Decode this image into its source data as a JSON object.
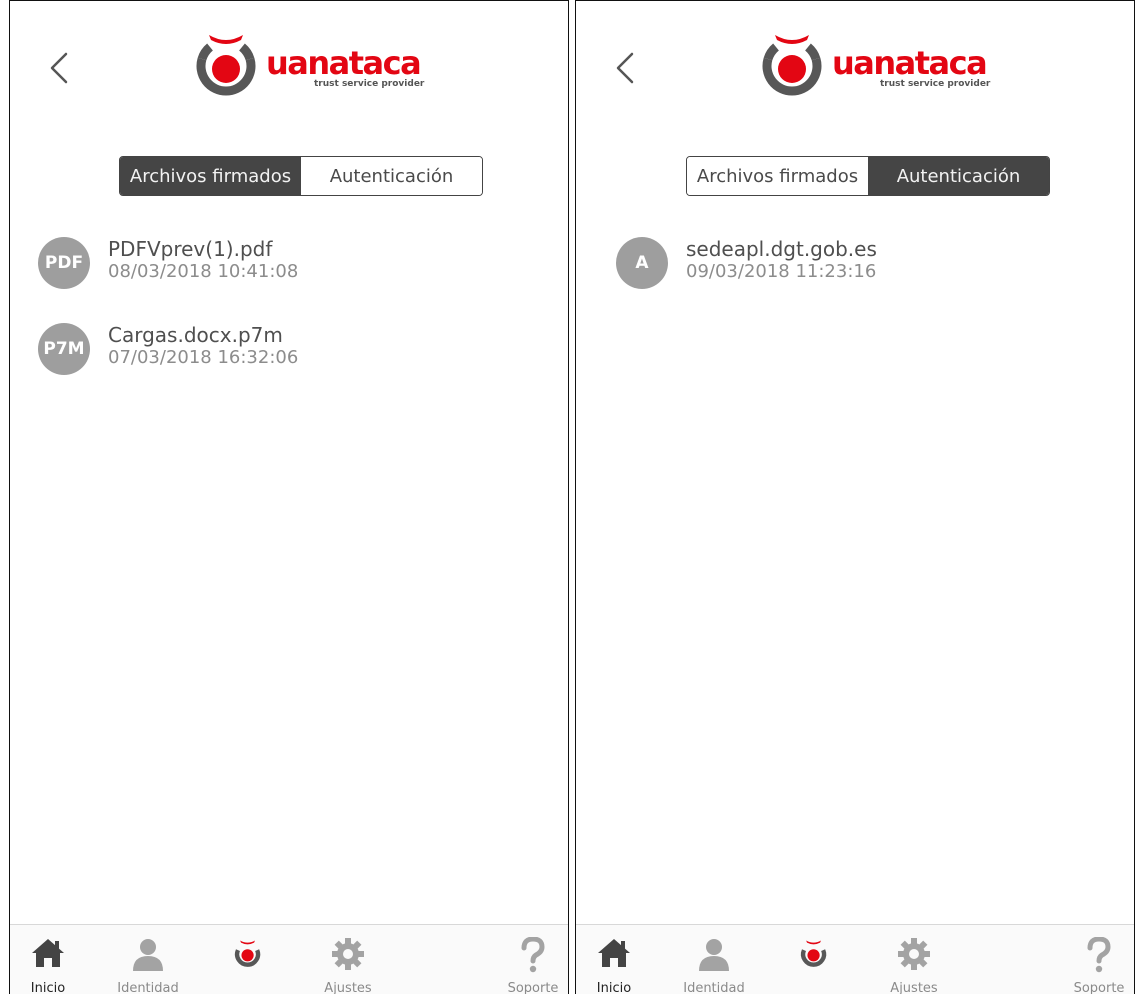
{
  "brand": {
    "wordmark": "uanataca",
    "tagline": "trust service provider",
    "red": "#e30613",
    "gray": "#575757"
  },
  "screens": [
    {
      "segments": [
        {
          "label": "Archivos firmados",
          "active": true
        },
        {
          "label": "Autenticación",
          "active": false
        }
      ],
      "items": [
        {
          "badge": "PDF",
          "title": "PDFVprev(1).pdf",
          "date": "08/03/2018 10:41:08"
        },
        {
          "badge": "P7M",
          "title": "Cargas.docx.p7m",
          "date": "07/03/2018 16:32:06"
        }
      ]
    },
    {
      "segments": [
        {
          "label": "Archivos firmados",
          "active": false
        },
        {
          "label": "Autenticación",
          "active": true
        }
      ],
      "items": [
        {
          "badge": "A",
          "title": "sedeapl.dgt.gob.es",
          "date": "09/03/2018 11:23:16"
        }
      ]
    }
  ],
  "tabbar": {
    "tabs": [
      {
        "label": "Inicio",
        "icon": "home-icon",
        "active": true
      },
      {
        "label": "Identidad",
        "icon": "person-icon",
        "active": false
      },
      {
        "label": "",
        "icon": "uanataca-logo-icon",
        "active": false
      },
      {
        "label": "Ajustes",
        "icon": "gear-icon",
        "active": false
      },
      {
        "label": "Soporte",
        "icon": "question-icon",
        "active": false
      }
    ]
  }
}
